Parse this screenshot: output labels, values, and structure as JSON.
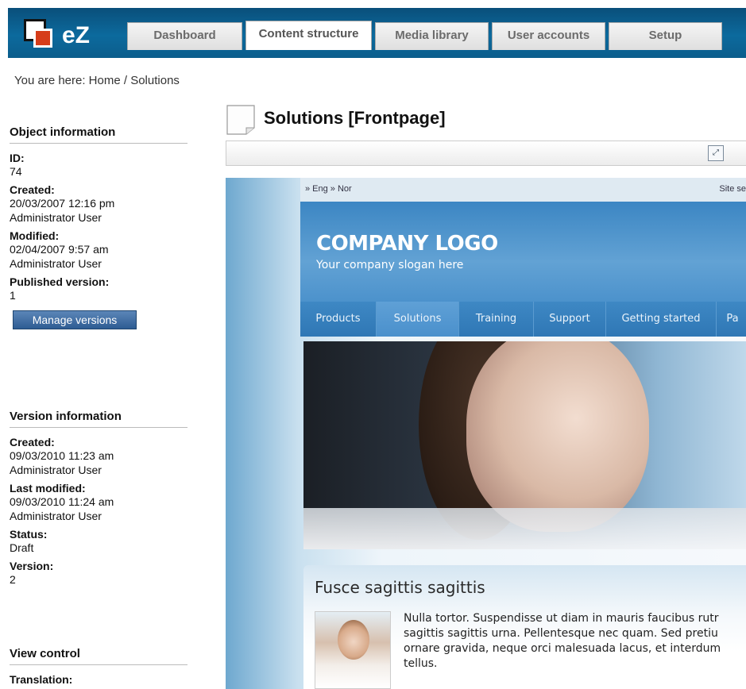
{
  "app": {
    "logo_text": "eZ"
  },
  "tabs": [
    {
      "label": "Dashboard"
    },
    {
      "label": "Content structure"
    },
    {
      "label": "Media library"
    },
    {
      "label": "User accounts"
    },
    {
      "label": "Setup"
    }
  ],
  "breadcrumb": {
    "text": "You are here: Home / Solutions"
  },
  "object_info": {
    "title": "Object information",
    "id_label": "ID:",
    "id_value": "74",
    "created_label": "Created:",
    "created_date": "20/03/2007 12:16 pm",
    "created_user": "Administrator User",
    "modified_label": "Modified:",
    "modified_date": "02/04/2007 9:57 am",
    "modified_user": "Administrator User",
    "published_label": "Published version:",
    "published_value": "1",
    "manage_button": "Manage versions"
  },
  "version_info": {
    "title": "Version information",
    "created_label": "Created:",
    "created_date": "09/03/2010 11:23 am",
    "created_user": "Administrator User",
    "last_modified_label": "Last modified:",
    "last_modified_date": "09/03/2010 11:24 am",
    "last_modified_user": "Administrator User",
    "status_label": "Status:",
    "status_value": "Draft",
    "version_label": "Version:",
    "version_value": "2"
  },
  "view_control": {
    "title": "View control",
    "translation_label": "Translation:"
  },
  "page": {
    "title": "Solutions [Frontpage]"
  },
  "preview": {
    "languages": "» Eng  » Nor",
    "site_search": "Site se",
    "company_logo": "COMPANY LOGO",
    "slogan": "Your company slogan here",
    "nav": [
      {
        "label": "Products"
      },
      {
        "label": "Solutions",
        "selected": true
      },
      {
        "label": "Training"
      },
      {
        "label": "Support"
      },
      {
        "label": "Getting started"
      },
      {
        "label": "Pa"
      }
    ],
    "article_title": "Fusce sagittis sagittis",
    "article_text": "Nulla tortor. Suspendisse ut diam in mauris faucibus rutr sagittis sagittis urna. Pellentesque nec quam. Sed pretiu ornare gravida, neque orci malesuada lacus, et interdum tellus."
  },
  "icons": {
    "fullscreen": "fullscreen-icon",
    "page": "page-icon"
  },
  "colors": {
    "topbar": "#0c6a9d",
    "logo_red": "#d63d1a",
    "button": "#2e5c93"
  }
}
